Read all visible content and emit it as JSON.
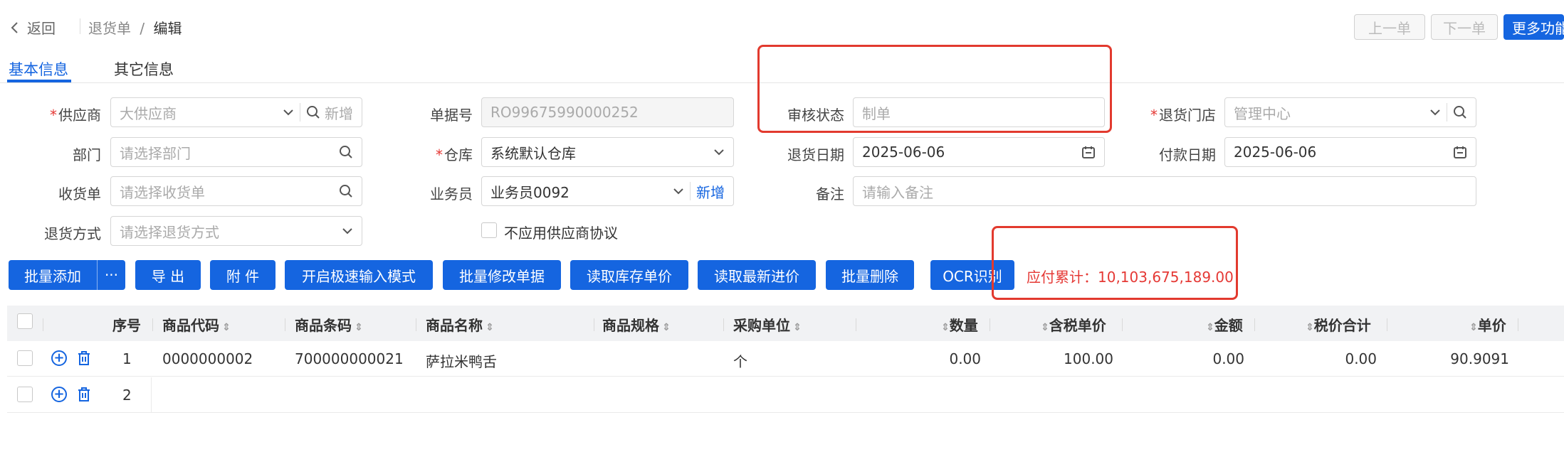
{
  "header": {
    "back_label": "返回",
    "breadcrumb_parent": "退货单",
    "breadcrumb_sep": "/",
    "breadcrumb_current": "编辑",
    "prev_label": "上一单",
    "next_label": "下一单",
    "more_label": "更多功能"
  },
  "tabs": [
    {
      "label": "基本信息",
      "active": true
    },
    {
      "label": "其它信息",
      "active": false
    }
  ],
  "form": {
    "supplier": {
      "label": "供应商",
      "required": true,
      "placeholder": "大供应商",
      "add_label": "新增"
    },
    "doc_no": {
      "label": "单据号",
      "value": "RO99675990000252"
    },
    "audit_status": {
      "label": "审核状态",
      "value": "制单"
    },
    "return_store": {
      "label": "退货门店",
      "required": true,
      "placeholder": "管理中心"
    },
    "department": {
      "label": "部门",
      "placeholder": "请选择部门"
    },
    "warehouse": {
      "label": "仓库",
      "required": true,
      "value": "系统默认仓库"
    },
    "return_date": {
      "label": "退货日期",
      "value": "2025-06-06"
    },
    "pay_date": {
      "label": "付款日期",
      "value": "2025-06-06"
    },
    "receipt": {
      "label": "收货单",
      "placeholder": "请选择收货单"
    },
    "salesman": {
      "label": "业务员",
      "value": "业务员0092",
      "add_label": "新增"
    },
    "remark": {
      "label": "备注",
      "placeholder": "请输入备注"
    },
    "return_method": {
      "label": "退货方式",
      "placeholder": "请选择退货方式"
    },
    "no_agreement": {
      "label": "不应用供应商协议",
      "checked": false
    }
  },
  "toolbar": {
    "batch_add": "批量添加",
    "more": "···",
    "export": "导 出",
    "attach": "附 件",
    "fast_input": "开启极速输入模式",
    "batch_edit": "批量修改单据",
    "read_stock_price": "读取库存单价",
    "read_latest_price": "读取最新进价",
    "batch_delete": "批量删除",
    "ocr": "OCR识别",
    "payable_label": "应付累计：",
    "payable_value": "10,103,675,189.00"
  },
  "table": {
    "columns": [
      "序号",
      "商品代码",
      "商品条码",
      "商品名称",
      "商品规格",
      "采购单位",
      "数量",
      "含税单价",
      "金额",
      "税价合计",
      "单价"
    ],
    "rows": [
      {
        "seq": "1",
        "code": "0000000002",
        "barcode": "700000000021",
        "name": "萨拉米鸭舌",
        "spec": "",
        "unit": "个",
        "qty": "0.00",
        "tax_price": "100.00",
        "amount": "0.00",
        "tax_total": "0.00",
        "price": "90.9091"
      },
      {
        "seq": "2",
        "code": "",
        "barcode": "",
        "name": "",
        "spec": "",
        "unit": "",
        "qty": "",
        "tax_price": "",
        "amount": "",
        "tax_total": "",
        "price": ""
      }
    ]
  },
  "colors": {
    "primary": "#1565e0",
    "danger": "#e53935",
    "highlight_box": "#e23a2e"
  }
}
